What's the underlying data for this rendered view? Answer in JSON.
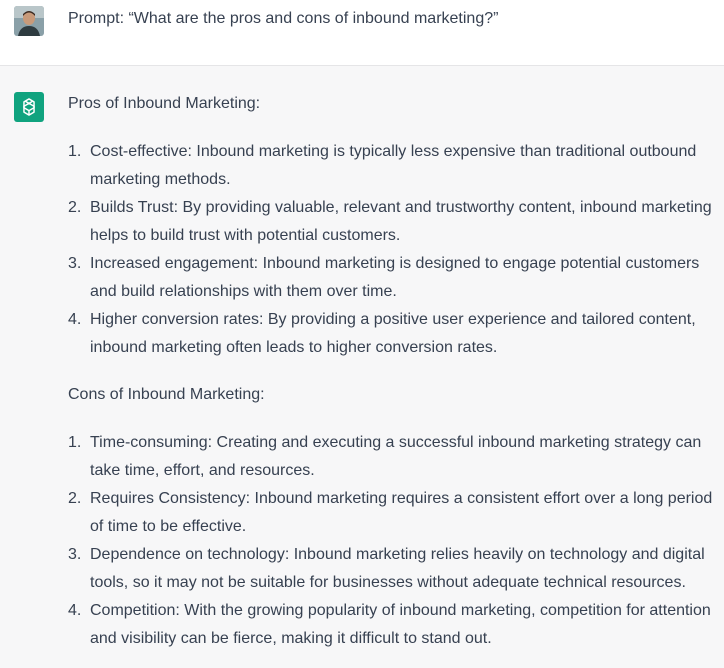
{
  "user": {
    "prompt": "Prompt:  “What are the pros and cons of inbound marketing?”"
  },
  "assistant": {
    "pros_heading": "Pros of Inbound Marketing:",
    "pros": [
      "Cost-effective: Inbound marketing is typically less expensive than traditional outbound marketing methods.",
      "Builds Trust: By providing valuable, relevant and trustworthy content, inbound marketing helps to build trust with potential customers.",
      "Increased engagement: Inbound marketing is designed to engage potential customers and build relationships with them over time.",
      "Higher conversion rates: By providing a positive user experience and tailored content, inbound marketing often leads to higher conversion rates."
    ],
    "cons_heading": "Cons of Inbound Marketing:",
    "cons": [
      "Time-consuming: Creating and executing a successful inbound marketing strategy can take time, effort, and resources.",
      "Requires Consistency: Inbound marketing requires a consistent effort over a long period of time to be effective.",
      "Dependence on technology: Inbound marketing relies heavily on technology and digital tools, so it may not be suitable for businesses without adequate technical resources.",
      "Competition: With the growing popularity of inbound marketing, competition for attention and visibility can be fierce, making it difficult to stand out."
    ],
    "numbers": [
      "1.",
      "2.",
      "3.",
      "4."
    ]
  },
  "colors": {
    "assistant_bg": "#f7f7f8",
    "brand": "#10a37f",
    "text": "#374151"
  },
  "icons": {
    "user_avatar": "user-avatar-photo",
    "assistant_avatar": "openai-logo-icon"
  }
}
